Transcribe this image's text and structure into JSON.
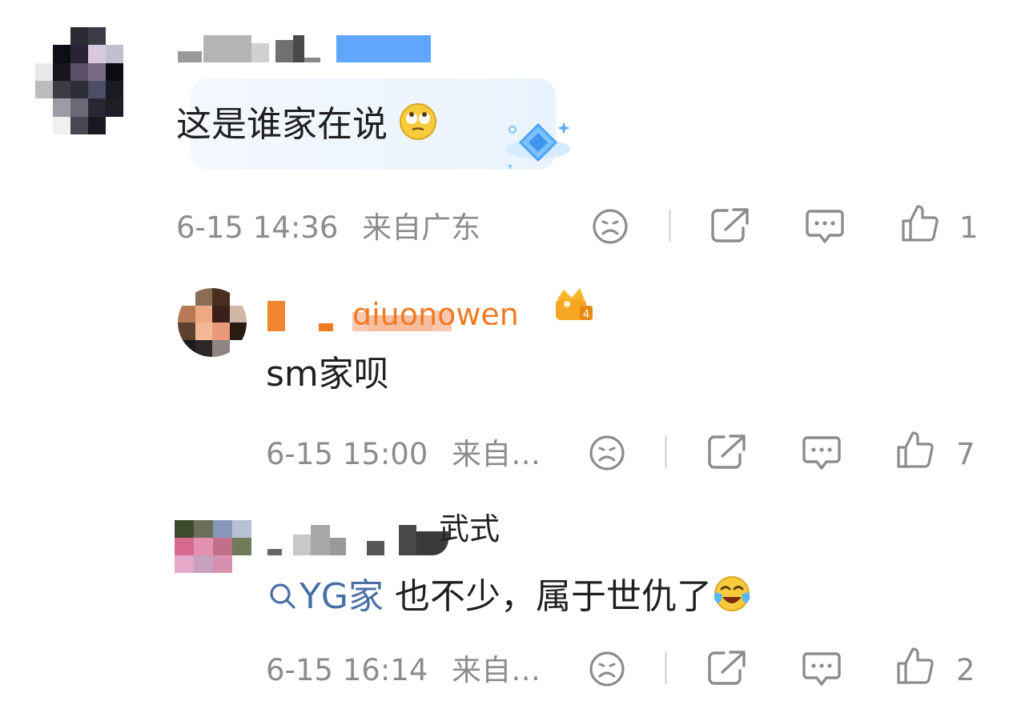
{
  "comments": [
    {
      "content": "这是谁家在说",
      "time": "6-15 14:36",
      "location": "来自广东",
      "likes": "1"
    },
    {
      "handle_visible": "gjuonowen",
      "content": "sm家呗",
      "time": "6-15 15:00",
      "location": "来自…",
      "likes": "7"
    },
    {
      "handle_visible": "武式",
      "topic_tag": "YG家",
      "content": " 也不少，属于世仇了",
      "time": "6-15 16:14",
      "location": "来自…",
      "likes": "2"
    }
  ],
  "icons": {
    "dislike": "sad-face-icon",
    "share": "share-icon",
    "reply": "comment-icon",
    "like": "thumbs-up-icon",
    "search": "search-icon"
  },
  "colors": {
    "meta_gray": "#8c8c8c",
    "topic_blue": "#4a6fa5",
    "name_orange": "#f07a24",
    "name_blue": "#4f9cff"
  }
}
